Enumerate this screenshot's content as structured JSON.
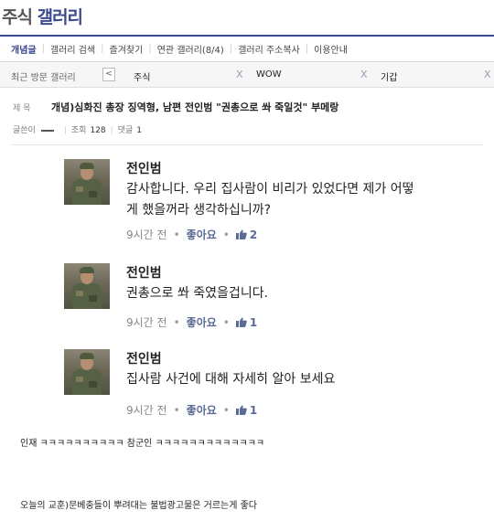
{
  "header": {
    "title_prefix": "주식",
    "title_suffix": "갤러리"
  },
  "menu": {
    "items": [
      "개념글",
      "갤러리 검색",
      "즐겨찾기",
      "연관 갤러리(8/4)",
      "갤러리 주소복사",
      "이용안내"
    ]
  },
  "recent": {
    "label": "최근 방문 갤러리",
    "prev_icon": "chevron-left-icon",
    "tabs": [
      {
        "label": "주식",
        "close": "X"
      },
      {
        "label": "WOW",
        "close": "X"
      },
      {
        "label": "기갑",
        "close": "X"
      }
    ]
  },
  "post": {
    "subject_label": "제 목",
    "subject": "개념)심화진 총장 징역형, 남편 전인범 \"권총으로 쏴 죽일것\" 부메랑",
    "writer_label": "글쓴이",
    "views_label": "조회",
    "views": "128",
    "replies_label": "댓글",
    "replies": "1"
  },
  "comments": [
    {
      "name": "전인범",
      "lines": [
        "감사합니다. 우리 집사람이 비리가 있었다면 제가 어떻",
        "게 했을꺼라 생각하십니까?"
      ],
      "time": "9시간 전",
      "like_label": "좋아요",
      "likes": "2"
    },
    {
      "name": "전인범",
      "lines": [
        "권총으로 쏴 죽였을겁니다."
      ],
      "time": "9시간 전",
      "like_label": "좋아요",
      "likes": "1"
    },
    {
      "name": "전인범",
      "lines": [
        "집사람 사건에 대해 자세히 알아 보세요"
      ],
      "time": "9시간 전",
      "like_label": "좋아요",
      "likes": "1"
    }
  ],
  "body": {
    "line1": "인재 ㅋㅋㅋㅋㅋㅋㅋㅋㅋㅋ    참군인 ㅋㅋㅋㅋㅋㅋㅋㅋㅋㅋㅋㅋㅋ",
    "line2": "오늘의 교훈)문베충들이 뿌려대는 불법광고물은 거르는게 좋다"
  },
  "colors": {
    "brand": "#3b4890",
    "like": "#5a6c96"
  }
}
